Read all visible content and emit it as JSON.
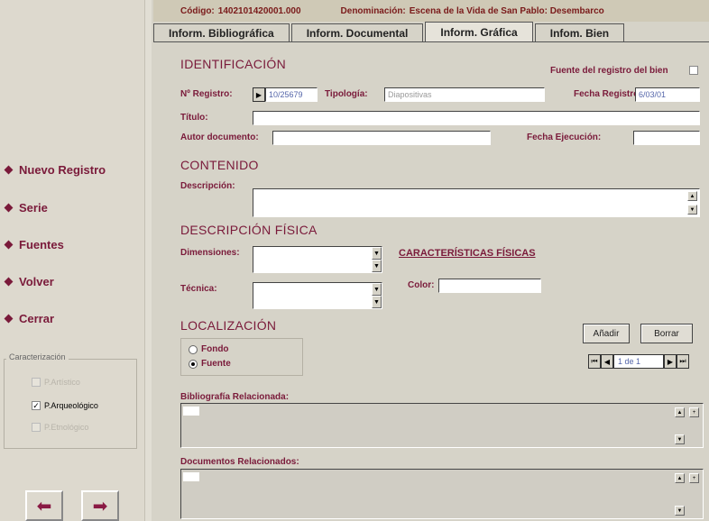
{
  "header": {
    "code_label": "Código:",
    "code_value": "1402101420001.000",
    "denom_label": "Denominación:",
    "denom_value": "Escena de la Vida de San Pablo: Desembarco"
  },
  "tabs": [
    {
      "label": "Inform. Bibliográfica"
    },
    {
      "label": "Inform. Documental"
    },
    {
      "label": "Inform. Gráfica"
    },
    {
      "label": "Infom. Bien"
    }
  ],
  "sidebar": {
    "items": [
      {
        "label": "Nuevo Registro"
      },
      {
        "label": "Serie"
      },
      {
        "label": "Fuentes"
      },
      {
        "label": "Volver"
      },
      {
        "label": "Cerrar"
      }
    ],
    "caracterizacion_title": "Caracterización",
    "checkboxes": [
      {
        "label": "P.Artístico",
        "checked": false,
        "enabled": false
      },
      {
        "label": "P.Arqueológico",
        "checked": true,
        "enabled": true
      },
      {
        "label": "P.Etnológico",
        "checked": false,
        "enabled": false
      }
    ],
    "prev_icon": "arrow-left-icon",
    "next_icon": "arrow-right-icon"
  },
  "identificacion": {
    "title": "IDENTIFICACIÓN",
    "fuente_label": "Fuente del registro del bien",
    "registro_label": "Nº Registro:",
    "registro_value": "10/25679",
    "tipologia_label": "Tipología:",
    "tipologia_value": "Diapositivas",
    "fecha_registro_label": "Fecha Registro:",
    "fecha_registro_value": "6/03/01",
    "titulo_label": "Título:",
    "autor_label": "Autor documento:",
    "fecha_ejecucion_label": "Fecha Ejecución:"
  },
  "contenido": {
    "title": "CONTENIDO",
    "descripcion_label": "Descripción:"
  },
  "descripcion_fisica": {
    "title": "DESCRIPCIÓN FÍSICA",
    "dimensiones_label": "Dimensiones:",
    "caracteristicas_link": "CARACTERÍSTICAS FÍSICAS",
    "tecnica_label": "Técnica:",
    "color_label": "Color:"
  },
  "localizacion": {
    "title": "LOCALIZACIÓN",
    "options": [
      {
        "label": "Fondo",
        "selected": false
      },
      {
        "label": "Fuente",
        "selected": true
      }
    ],
    "add_button": "Añadir",
    "delete_button": "Borrar",
    "record_position": "1 de 1"
  },
  "bibliografia": {
    "label": "Bibliografía Relacionada:"
  },
  "documentos": {
    "label": "Documentos Relacionados:"
  }
}
